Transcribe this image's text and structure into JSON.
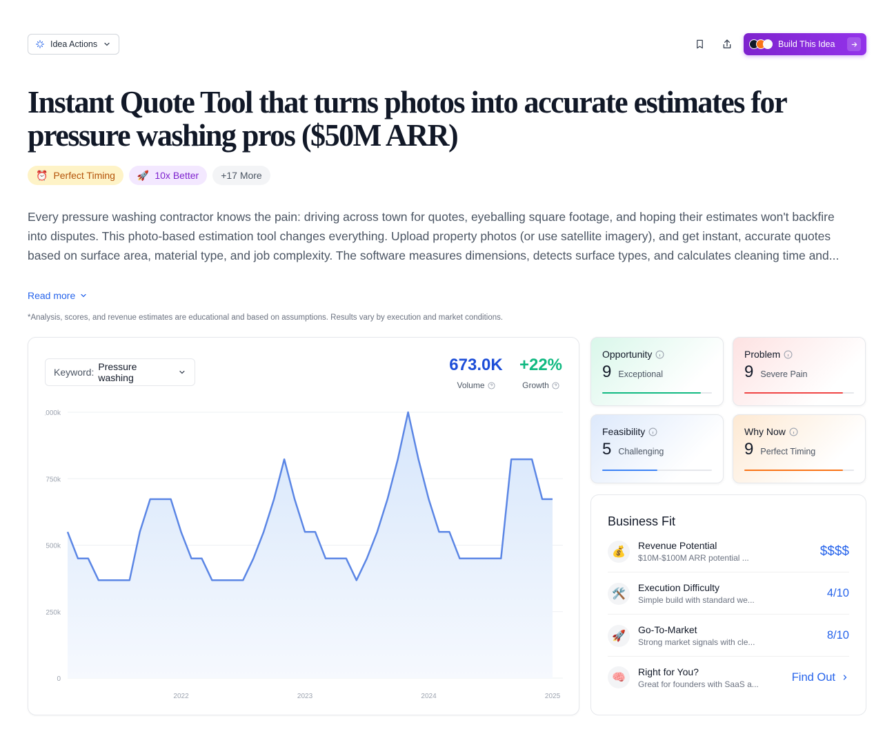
{
  "toolbar": {
    "idea_actions_label": "Idea Actions",
    "build_label": "Build This Idea"
  },
  "title": "Instant Quote Tool that turns photos into accurate estimates for pressure washing pros ($50M ARR)",
  "tags": [
    {
      "emoji": "⏰",
      "label": "Perfect Timing"
    },
    {
      "emoji": "🚀",
      "label": "10x Better"
    },
    {
      "emoji": "",
      "label": "+17 More"
    }
  ],
  "description": "Every pressure washing contractor knows the pain: driving across town for quotes, eyeballing square footage, and hoping their estimates won't backfire into disputes. This photo-based estimation tool changes everything. Upload property photos (or use satellite imagery), and get instant, accurate quotes based on surface area, material type, and job complexity. The software measures dimensions, detects surface types, and calculates cleaning time and...",
  "read_more": "Read more",
  "disclaimer": "*Analysis, scores, and revenue estimates are educational and based on assumptions. Results vary by execution and market conditions.",
  "keyword": {
    "label": "Keyword:",
    "value": "Pressure washing"
  },
  "metrics": {
    "volume": {
      "value": "673.0K",
      "label": "Volume"
    },
    "growth": {
      "value": "+22%",
      "label": "Growth"
    }
  },
  "chart_data": {
    "type": "area",
    "ylim": [
      0,
      1000000
    ],
    "yticks": [
      "1,000k",
      "750k",
      "500k",
      "250k",
      "0"
    ],
    "xticks": [
      "2022",
      "2023",
      "2024",
      "2025"
    ],
    "xlim": [
      "2021-08",
      "2025-08"
    ],
    "x": [
      "2021-08",
      "2021-09",
      "2021-10",
      "2021-11",
      "2021-12",
      "2022-01",
      "2022-02",
      "2022-03",
      "2022-04",
      "2022-05",
      "2022-06",
      "2022-07",
      "2022-08",
      "2022-09",
      "2022-10",
      "2022-11",
      "2022-12",
      "2023-01",
      "2023-02",
      "2023-03",
      "2023-04",
      "2023-05",
      "2023-06",
      "2023-07",
      "2023-08",
      "2023-09",
      "2023-10",
      "2023-11",
      "2023-12",
      "2024-01",
      "2024-02",
      "2024-03",
      "2024-04",
      "2024-05",
      "2024-06",
      "2024-07",
      "2024-08",
      "2024-09",
      "2024-10",
      "2024-11",
      "2024-12",
      "2025-01",
      "2025-02",
      "2025-03",
      "2025-04",
      "2025-05",
      "2025-06",
      "2025-07",
      "2025-08"
    ],
    "values": [
      550000,
      450000,
      450000,
      368000,
      368000,
      368000,
      368000,
      550000,
      673000,
      673000,
      673000,
      550000,
      450000,
      450000,
      368000,
      368000,
      368000,
      368000,
      450000,
      550000,
      673000,
      823000,
      673000,
      550000,
      550000,
      450000,
      450000,
      450000,
      368000,
      450000,
      550000,
      673000,
      823000,
      1000000,
      823000,
      673000,
      550000,
      550000,
      450000,
      450000,
      450000,
      450000,
      450000,
      823000,
      823000,
      823000,
      673000,
      673000
    ],
    "colors": {
      "line": "#5b86e5",
      "fill_top": "#d6e6fb",
      "fill_bottom": "#f6f9fe",
      "grid": "#eef0f3"
    }
  },
  "scores": [
    {
      "label": "Opportunity",
      "value": "9",
      "desc": "Exceptional",
      "level": 0.9,
      "color": "#10b981"
    },
    {
      "label": "Problem",
      "value": "9",
      "desc": "Severe Pain",
      "level": 0.9,
      "color": "#ef4444"
    },
    {
      "label": "Feasibility",
      "value": "5",
      "desc": "Challenging",
      "level": 0.5,
      "color": "#3b82f6"
    },
    {
      "label": "Why Now",
      "value": "9",
      "desc": "Perfect Timing",
      "level": 0.9,
      "color": "#f97316"
    }
  ],
  "business_fit": {
    "title": "Business Fit",
    "rows": [
      {
        "emoji": "💰",
        "title": "Revenue Potential",
        "sub": "$10M-$100M ARR potential ...",
        "value": "$$$$"
      },
      {
        "emoji": "🛠️",
        "title": "Execution Difficulty",
        "sub": "Simple build with standard we...",
        "value": "4/10"
      },
      {
        "emoji": "🚀",
        "title": "Go-To-Market",
        "sub": "Strong market signals with cle...",
        "value": "8/10"
      },
      {
        "emoji": "🧠",
        "title": "Right for You?",
        "sub": "Great for founders with SaaS a...",
        "value": "Find Out"
      }
    ]
  }
}
